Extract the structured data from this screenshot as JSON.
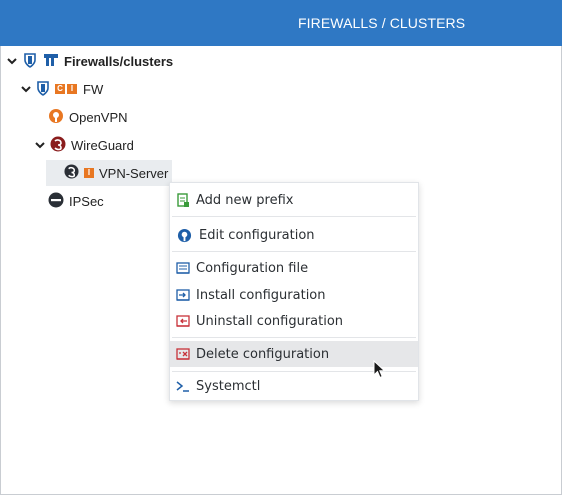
{
  "header": {
    "title": "FIREWALLS / CLUSTERS"
  },
  "tree": {
    "root": {
      "label": "Firewalls/clusters"
    },
    "fw": {
      "label": "FW",
      "badges": [
        "C",
        "I"
      ]
    },
    "openvpn": {
      "label": "OpenVPN"
    },
    "wireguard": {
      "label": "WireGuard"
    },
    "vpn_server": {
      "label": "VPN-Server",
      "badge": "I"
    },
    "ipsec": {
      "label": "IPSec"
    }
  },
  "context_menu": {
    "items": [
      {
        "label": "Add new prefix",
        "icon": "add-prefix-icon"
      },
      {
        "label": "Edit configuration",
        "icon": "openvpn-edit-icon"
      },
      {
        "label": "Configuration file",
        "icon": "config-file-icon"
      },
      {
        "label": "Install configuration",
        "icon": "install-icon"
      },
      {
        "label": "Uninstall configuration",
        "icon": "uninstall-icon"
      },
      {
        "label": "Delete configuration",
        "icon": "delete-icon"
      },
      {
        "label": "Systemctl",
        "icon": "terminal-icon"
      }
    ]
  },
  "colors": {
    "header_bg": "#2f78c4",
    "accent_blue": "#1f5fa8",
    "orange": "#e87722",
    "red": "#c8323a",
    "wireguard": "#8a1c1c"
  }
}
